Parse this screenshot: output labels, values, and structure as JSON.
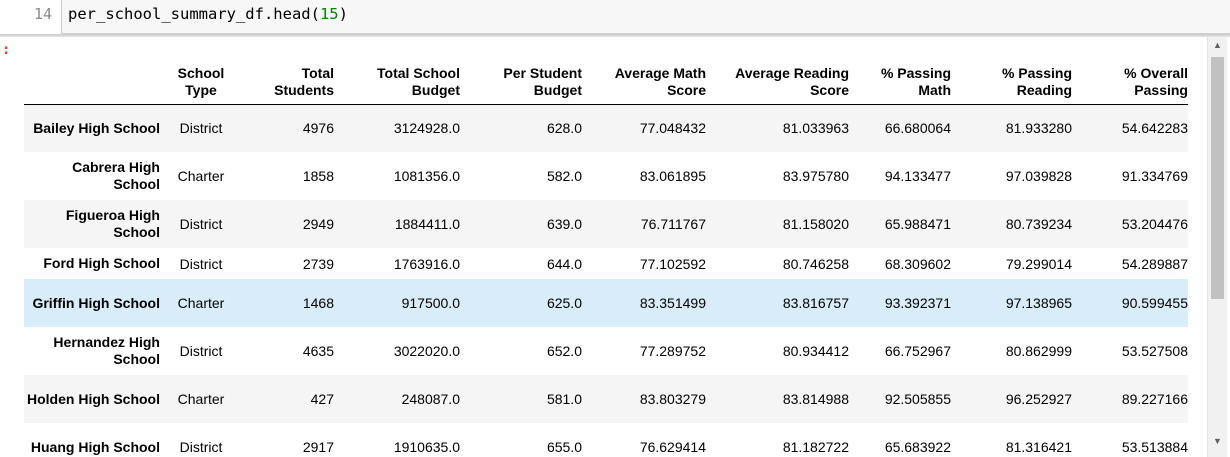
{
  "input_cell": {
    "prompt": "14",
    "code_fn": "per_school_summary_df.head(",
    "code_arg": "15",
    "code_end": ")"
  },
  "output": {
    "prompt_marker": ":"
  },
  "table": {
    "columns": [
      "School\nType",
      "Total\nStudents",
      "Total School\nBudget",
      "Per Student\nBudget",
      "Average Math\nScore",
      "Average Reading\nScore",
      "% Passing\nMath",
      "% Passing\nReading",
      "% Overall\nPassing"
    ],
    "rows": [
      {
        "school": "Bailey High School",
        "type": "District",
        "students": "4976",
        "budget": "3124928.0",
        "per_student": "628.0",
        "math": "77.048432",
        "reading": "81.033963",
        "pass_math": "66.680064",
        "pass_reading": "81.933280",
        "overall": "54.642283"
      },
      {
        "school": "Cabrera High School",
        "type": "Charter",
        "students": "1858",
        "budget": "1081356.0",
        "per_student": "582.0",
        "math": "83.061895",
        "reading": "83.975780",
        "pass_math": "94.133477",
        "pass_reading": "97.039828",
        "overall": "91.334769"
      },
      {
        "school": "Figueroa High School",
        "type": "District",
        "students": "2949",
        "budget": "1884411.0",
        "per_student": "639.0",
        "math": "76.711767",
        "reading": "81.158020",
        "pass_math": "65.988471",
        "pass_reading": "80.739234",
        "overall": "53.204476"
      },
      {
        "school": "Ford High School",
        "type": "District",
        "students": "2739",
        "budget": "1763916.0",
        "per_student": "644.0",
        "math": "77.102592",
        "reading": "80.746258",
        "pass_math": "68.309602",
        "pass_reading": "79.299014",
        "overall": "54.289887"
      },
      {
        "school": "Griffin High School",
        "type": "Charter",
        "students": "1468",
        "budget": "917500.0",
        "per_student": "625.0",
        "math": "83.351499",
        "reading": "83.816757",
        "pass_math": "93.392371",
        "pass_reading": "97.138965",
        "overall": "90.599455"
      },
      {
        "school": "Hernandez High School",
        "type": "District",
        "students": "4635",
        "budget": "3022020.0",
        "per_student": "652.0",
        "math": "77.289752",
        "reading": "80.934412",
        "pass_math": "66.752967",
        "pass_reading": "80.862999",
        "overall": "53.527508"
      },
      {
        "school": "Holden High School",
        "type": "Charter",
        "students": "427",
        "budget": "248087.0",
        "per_student": "581.0",
        "math": "83.803279",
        "reading": "83.814988",
        "pass_math": "92.505855",
        "pass_reading": "96.252927",
        "overall": "89.227166"
      },
      {
        "school": "Huang High School",
        "type": "District",
        "students": "2917",
        "budget": "1910635.0",
        "per_student": "655.0",
        "math": "76.629414",
        "reading": "81.182722",
        "pass_math": "65.683922",
        "pass_reading": "81.316421",
        "overall": "53.513884"
      }
    ]
  },
  "colors": {
    "row_stripe": "#f5f5f5",
    "row_hover": "#d9ecf9",
    "code_number": "#008000",
    "out_prompt": "#d84315"
  },
  "icons": {
    "scroll_up": "triangle-up-icon",
    "scroll_down": "triangle-down-icon"
  }
}
